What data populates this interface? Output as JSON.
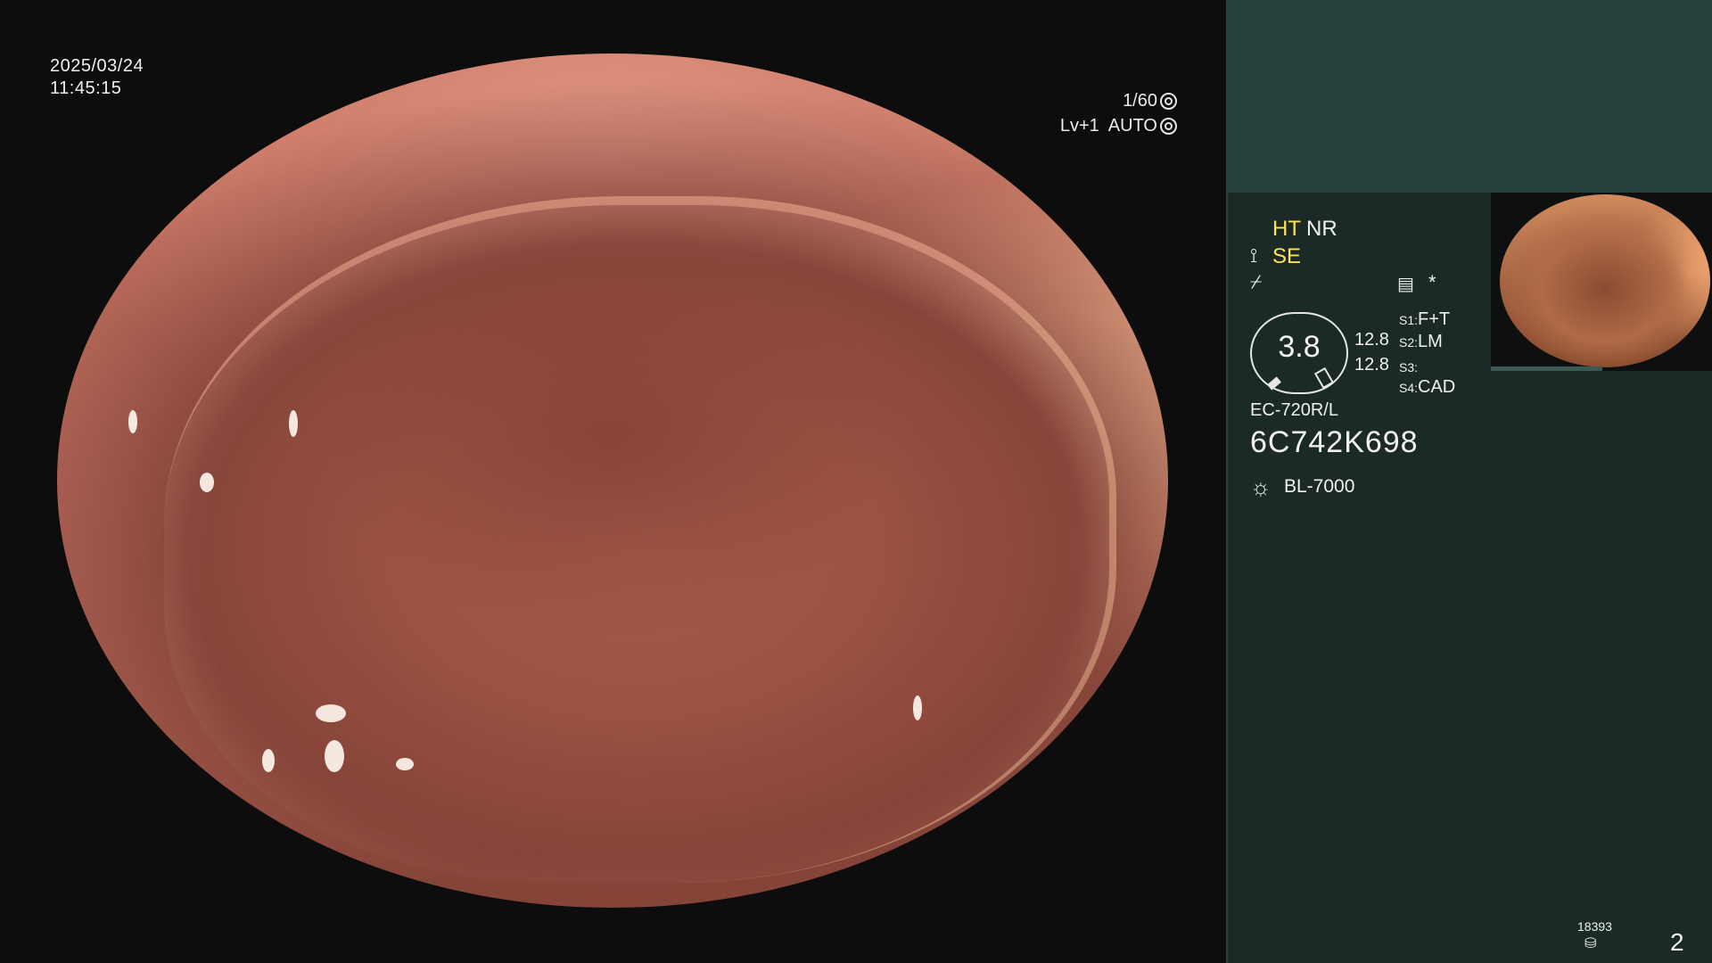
{
  "overlay": {
    "date": "2025/03/24",
    "time": "11:45:15",
    "shutter": "1/60",
    "shutter_icon": "aperture-icon",
    "level": "Lv+1",
    "iris_mode": "AUTO",
    "iris_icon": "iris-icon"
  },
  "panel": {
    "ht": "HT",
    "nr": "NR",
    "se": "SE",
    "se_icon": "scope-edge-icon",
    "flash_icon": "flash-icon",
    "memo_icon": "memo-icon",
    "star": "*",
    "gauge_value": "3.8",
    "value1": "12.8",
    "value2": "12.8",
    "switches": [
      {
        "key": "S1:",
        "value": "F+T"
      },
      {
        "key": "S2:",
        "value": "LM"
      },
      {
        "key": "S3:",
        "value": ""
      },
      {
        "key": "S4:",
        "value": "CAD"
      }
    ],
    "scope_model": "EC-720R/L",
    "scope_serial": "6C742K698",
    "light_icon": "sun-icon",
    "light_source": "BL-7000",
    "counter": "18393",
    "counter_icon": "disk-icon",
    "page": "2"
  },
  "colors": {
    "panel_bg": "#1b2a27",
    "panel_top_bg": "#26413b",
    "highlight": "#ffe34a"
  }
}
